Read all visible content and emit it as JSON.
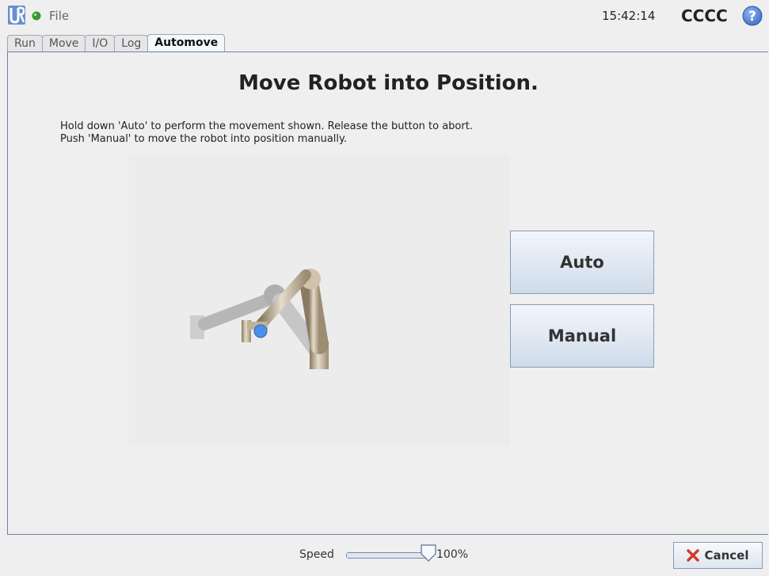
{
  "header": {
    "file_label": "File",
    "time": "15:42:14",
    "robot_name": "CCCC",
    "icons": {
      "logo": "ur-logo",
      "status": "status-green-dot-icon",
      "help": "help-icon"
    },
    "status_color": "#2e9b2e"
  },
  "tabs": [
    {
      "label": "Run",
      "active": false
    },
    {
      "label": "Move",
      "active": false
    },
    {
      "label": "I/O",
      "active": false
    },
    {
      "label": "Log",
      "active": false
    },
    {
      "label": "Automove",
      "active": true
    }
  ],
  "main": {
    "title": "Move Robot into Position.",
    "instruction_line1": "Hold down 'Auto' to perform the movement shown. Release the button to abort.",
    "instruction_line2": "Push 'Manual' to move the robot into position manually.",
    "auto_label": "Auto",
    "manual_label": "Manual"
  },
  "footer": {
    "speed_label": "Speed",
    "speed_value": "100%",
    "speed_fraction": 1.0,
    "cancel_label": "Cancel",
    "cancel_icon": "red-x-icon"
  },
  "colors": {
    "accent_border": "#6e82a2",
    "button_top": "#f2f6fb",
    "button_bottom": "#cfdbea"
  }
}
